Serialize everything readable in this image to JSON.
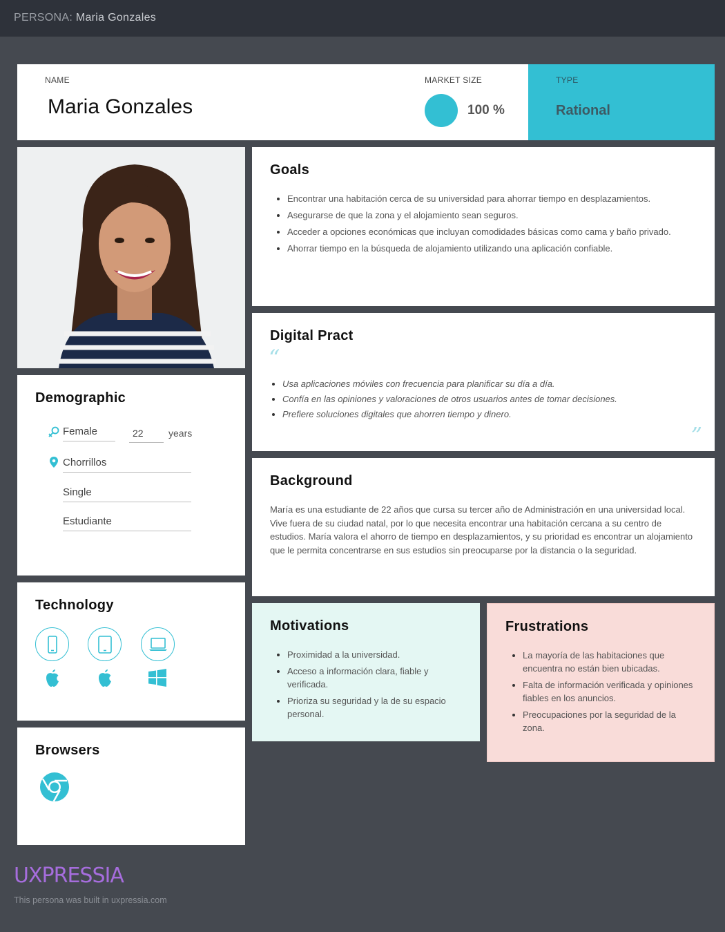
{
  "topbar": {
    "prefix": "PERSONA:",
    "name": "Maria Gonzales"
  },
  "header": {
    "name_label": "NAME",
    "name": "Maria Gonzales",
    "market_label": "MARKET SIZE",
    "market_value": "100 %",
    "type_label": "TYPE",
    "type_value": "Rational"
  },
  "goals": {
    "title": "Goals",
    "items": [
      "Encontrar una habitación cerca de su universidad para ahorrar tiempo en desplazamientos.",
      "Asegurarse de que la zona y el alojamiento sean seguros.",
      "Acceder a opciones económicas que incluyan comodidades básicas como cama y baño privado.",
      "Ahorrar tiempo en la búsqueda de alojamiento utilizando una aplicación confiable."
    ]
  },
  "digital": {
    "title": "Digital Pract",
    "items": [
      "Usa aplicaciones móviles con frecuencia para planificar su día a día.",
      "Confía en las opiniones y valoraciones de otros usuarios antes de tomar decisiones.",
      "Prefiere soluciones digitales que ahorren tiempo y dinero."
    ]
  },
  "background": {
    "title": "Background",
    "text": "María es una estudiante de 22 años que cursa su tercer año de Administración en una universidad local. Vive fuera de su ciudad natal, por lo que necesita encontrar una habitación cercana a su centro de estudios. María valora el ahorro de tiempo en desplazamientos, y su prioridad es encontrar un alojamiento que le permita concentrarse en sus estudios sin preocuparse por la distancia o la seguridad."
  },
  "demographic": {
    "title": "Demographic",
    "gender": "Female",
    "age": "22",
    "age_unit": "years",
    "location": "Chorrillos",
    "status": "Single",
    "occupation": "Estudiante"
  },
  "technology": {
    "title": "Technology",
    "devices": [
      "phone-icon",
      "tablet-icon",
      "laptop-icon"
    ],
    "os": [
      "apple-icon",
      "apple-icon",
      "windows-icon"
    ]
  },
  "browsers": {
    "title": "Browsers",
    "items": [
      "chrome-icon"
    ]
  },
  "motivations": {
    "title": "Motivations",
    "items": [
      "Proximidad a la universidad.",
      "Acceso a información clara, fiable y verificada.",
      "Prioriza su seguridad y la de su espacio personal."
    ]
  },
  "frustrations": {
    "title": "Frustrations",
    "items": [
      "La mayoría de las habitaciones que encuentra no están bien ubicadas.",
      "Falta de información verificada y opiniones fiables en los anuncios.",
      "Preocupaciones por la seguridad de la zona."
    ]
  },
  "footer": {
    "logo": "UXPRESSIA",
    "note": "This persona was built in uxpressia.com"
  },
  "colors": {
    "accent": "#33bfd3",
    "motivations_bg": "#e4f7f3",
    "frustrations_bg": "#f9dcd9",
    "logo": "#a66ddd"
  }
}
